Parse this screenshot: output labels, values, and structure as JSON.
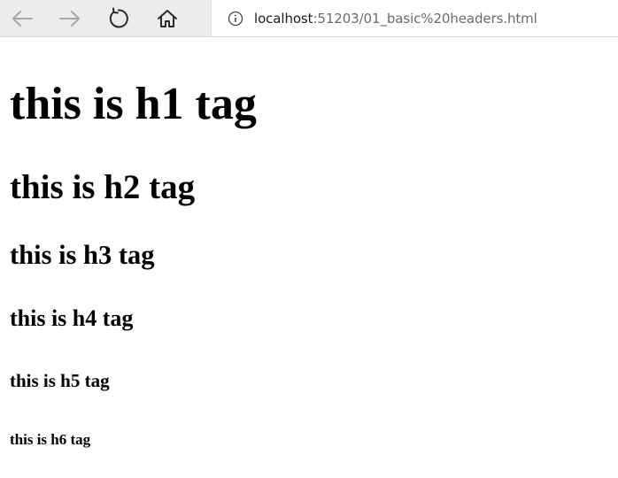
{
  "browser": {
    "back_icon": "arrow-left-icon",
    "forward_icon": "arrow-right-icon",
    "refresh_icon": "refresh-icon",
    "home_icon": "home-icon",
    "info_icon": "info-icon",
    "url_host": "localhost",
    "url_rest": ":51203/01_basic%20headers.html"
  },
  "page": {
    "headings": [
      "this is h1 tag",
      "this is h2 tag",
      "this is h3 tag",
      "this is h4 tag",
      "this is h5 tag",
      "this is h6 tag"
    ]
  }
}
